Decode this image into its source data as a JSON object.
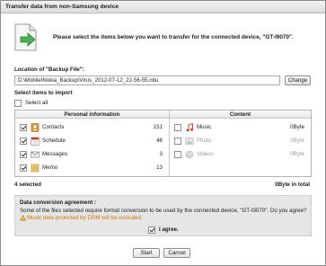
{
  "window": {
    "title": "Transfer data from non-Samsung device"
  },
  "intro_text": "Please select the items below you want to transfer for the connected device, \"GT-I9070\".",
  "backup": {
    "label": "Location of \"Backup File\":",
    "path": "D:\\Mobile\\Nokia_Backup\\Virus_2012-07-12_22-56-55.nbu",
    "change_label": "Change"
  },
  "select": {
    "label": "Select items to import",
    "select_all_label": "Select all",
    "select_all_checked": false
  },
  "table": {
    "personal_header": "Personal information",
    "content_header": "Content",
    "personal": [
      {
        "icon": "contacts-icon",
        "label": "Contacts",
        "count": "151",
        "checked": true
      },
      {
        "icon": "schedule-icon",
        "label": "Schedule",
        "count": "46",
        "checked": true
      },
      {
        "icon": "messages-icon",
        "label": "Messages",
        "count": "3",
        "checked": true
      },
      {
        "icon": "memo-icon",
        "label": "Memo",
        "count": "13",
        "checked": true
      }
    ],
    "content": [
      {
        "icon": "music-icon",
        "label": "Music",
        "size": "0Byte",
        "checked": false,
        "enabled": true
      },
      {
        "icon": "photo-icon",
        "label": "Photo",
        "size": "0Byte",
        "checked": false,
        "enabled": false
      },
      {
        "icon": "videos-icon",
        "label": "Videos",
        "size": "0Byte",
        "checked": false,
        "enabled": false
      }
    ]
  },
  "summary": {
    "selected": "4 selected",
    "total": "0Byte in total"
  },
  "agreement": {
    "title": "Data conversion agreement :",
    "text": "Some of the files selected require format conversion to be used by the connected device, \"GT-I9070\". Do you agree?",
    "drm_note": "Music data protected by DRM will be excluded.",
    "agree_label": "I agree.",
    "agree_checked": true
  },
  "buttons": {
    "start": "Start",
    "cancel": "Cancel"
  },
  "colors": {
    "warning": "#cc7a00",
    "accent_green": "#4caf50",
    "titlebar": "#e4e4e4"
  }
}
